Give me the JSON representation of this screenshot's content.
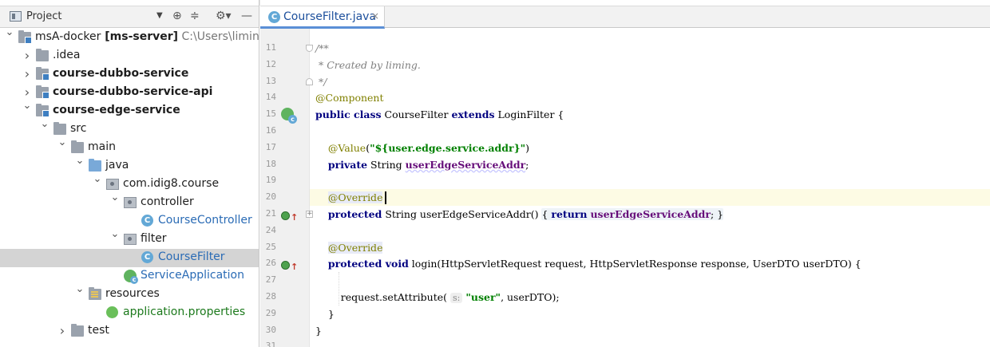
{
  "project_panel": {
    "title": "Project",
    "tools": [
      "⊕",
      "≑",
      "⚙▾",
      "—"
    ],
    "tree": [
      {
        "level": 0,
        "expanded": true,
        "icon": "module-icon",
        "label": "msA-docker",
        "bold_suffix": "[ms-server]",
        "hint": "C:\\Users\\liming\\De",
        "style": ""
      },
      {
        "level": 1,
        "expanded": false,
        "icon": "folder-icon",
        "label": ".idea",
        "style": ""
      },
      {
        "level": 1,
        "expanded": false,
        "icon": "module-icon",
        "label": "course-dubbo-service",
        "style": "bold"
      },
      {
        "level": 1,
        "expanded": false,
        "icon": "module-icon",
        "label": "course-dubbo-service-api",
        "style": "bold"
      },
      {
        "level": 1,
        "expanded": true,
        "icon": "module-icon",
        "label": "course-edge-service",
        "style": "bold"
      },
      {
        "level": 2,
        "expanded": true,
        "icon": "folder-icon",
        "label": "src",
        "style": ""
      },
      {
        "level": 3,
        "expanded": true,
        "icon": "folder-icon",
        "label": "main",
        "style": ""
      },
      {
        "level": 4,
        "expanded": true,
        "icon": "source-folder-icon",
        "label": "java",
        "style": ""
      },
      {
        "level": 5,
        "expanded": true,
        "icon": "package-icon",
        "label": "com.idig8.course",
        "style": ""
      },
      {
        "level": 6,
        "expanded": true,
        "icon": "package-icon",
        "label": "controller",
        "style": ""
      },
      {
        "level": 7,
        "expanded": null,
        "icon": "class-icon",
        "label": "CourseController",
        "style": "blue"
      },
      {
        "level": 6,
        "expanded": true,
        "icon": "package-icon",
        "label": "filter",
        "style": ""
      },
      {
        "level": 7,
        "expanded": null,
        "icon": "class-icon",
        "label": "CourseFilter",
        "style": "blue",
        "selected": true
      },
      {
        "level": 6,
        "expanded": null,
        "icon": "spring-class-icon",
        "label": "ServiceApplication",
        "style": "blue"
      },
      {
        "level": 4,
        "expanded": true,
        "icon": "resources-folder-icon",
        "label": "resources",
        "style": ""
      },
      {
        "level": 5,
        "expanded": null,
        "icon": "properties-icon",
        "label": "application.properties",
        "style": "green"
      },
      {
        "level": 3,
        "expanded": false,
        "icon": "folder-icon",
        "label": "test",
        "style": ""
      }
    ]
  },
  "editor": {
    "tab": {
      "label": "CourseFilter.java",
      "icon_letter": "C",
      "close": "×"
    },
    "lines": [
      {
        "num": "11",
        "html": "<span class=\"comment\">/**</span>"
      },
      {
        "num": "12",
        "html": "<span class=\"comment\"> * Created by liming.</span>"
      },
      {
        "num": "13",
        "html": "<span class=\"comment\"> */</span>"
      },
      {
        "num": "14",
        "html": "<span class=\"ann\">@Component</span>"
      },
      {
        "num": "15",
        "html": "<span class=\"kw\">public class</span> CourseFilter <span class=\"kw\">extends</span> LoginFilter {"
      },
      {
        "num": "16",
        "html": ""
      },
      {
        "num": "17",
        "html": "    <span class=\"ann\">@Value</span>(<span class=\"str\">\"${user.edge.service.addr}\"</span>)"
      },
      {
        "num": "18",
        "html": "    <span class=\"kw\">private</span> String <span class=\"field squiggle\">userEdgeServiceAddr</span>;"
      },
      {
        "num": "19",
        "html": ""
      },
      {
        "num": "20",
        "html": "    <span class=\"ann ann-box\">@Override</span>",
        "highlight": true
      },
      {
        "num": "21",
        "html": "    <span class=\"kw\">protected</span> String userEdgeServiceAddr() <span class=\"fold-brace\">{ <span class=\"kw\">return</span> <span class=\"field\">userEdgeServiceAddr</span>; }</span>"
      },
      {
        "num": "24",
        "html": ""
      },
      {
        "num": "25",
        "html": "    <span class=\"ann ann-box\">@Override</span>"
      },
      {
        "num": "26",
        "html": "    <span class=\"kw\">protected void</span> login(HttpServletRequest request, HttpServletResponse response, UserDTO userDTO) {"
      },
      {
        "num": "27",
        "html": ""
      },
      {
        "num": "28",
        "html": "        request.setAttribute( <span class=\"hint\">s:</span> <span class=\"str\">\"user\"</span>, userDTO);"
      },
      {
        "num": "29",
        "html": "    }"
      },
      {
        "num": "30",
        "html": "}"
      },
      {
        "num": "31",
        "html": ""
      }
    ]
  },
  "colors": {
    "accent": "#5a8fd6",
    "selection": "#d4d4d4",
    "caret_line": "#fdfbe4"
  }
}
